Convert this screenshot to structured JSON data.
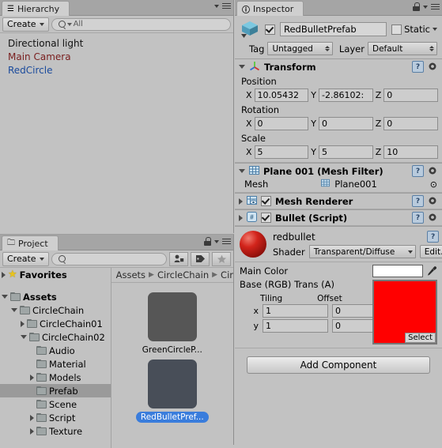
{
  "hierarchy": {
    "tab_label": "Hierarchy",
    "create_label": "Create",
    "search_placeholder": "All",
    "items": [
      {
        "label": "Directional light",
        "color": "#111111"
      },
      {
        "label": "Main Camera",
        "color": "#7a2020"
      },
      {
        "label": "RedCircle",
        "color": "#1a4a9c"
      }
    ]
  },
  "project": {
    "tab_label": "Project",
    "create_label": "Create",
    "search_placeholder": "",
    "favorites_label": "Favorites",
    "tree": [
      {
        "label": "Assets",
        "depth": 0,
        "state": "open",
        "bold": true
      },
      {
        "label": "CircleChain",
        "depth": 1,
        "state": "open",
        "bold": false
      },
      {
        "label": "CircleChain01",
        "depth": 2,
        "state": "closed",
        "bold": false
      },
      {
        "label": "CircleChain02",
        "depth": 2,
        "state": "open",
        "bold": false
      },
      {
        "label": "Audio",
        "depth": 3,
        "state": "leaf",
        "bold": false
      },
      {
        "label": "Material",
        "depth": 3,
        "state": "leaf",
        "bold": false
      },
      {
        "label": "Models",
        "depth": 3,
        "state": "closed",
        "bold": false
      },
      {
        "label": "Prefab",
        "depth": 3,
        "state": "leaf",
        "bold": false,
        "selected": true
      },
      {
        "label": "Scene",
        "depth": 3,
        "state": "leaf",
        "bold": false
      },
      {
        "label": "Script",
        "depth": 3,
        "state": "closed",
        "bold": false
      },
      {
        "label": "Texture",
        "depth": 3,
        "state": "closed",
        "bold": false
      }
    ],
    "breadcrumb": [
      "Assets",
      "CircleChain",
      "Cir"
    ],
    "assets": [
      {
        "label": "GreenCircleP...",
        "color": "#565656",
        "selected": false
      },
      {
        "label": "RedBulletPref...",
        "color": "#484e58",
        "selected": true
      }
    ]
  },
  "inspector": {
    "tab_label": "Inspector",
    "object_name": "RedBulletPrefab",
    "object_enabled": true,
    "static_label": "Static",
    "static_checked": false,
    "tag_label": "Tag",
    "tag_value": "Untagged",
    "layer_label": "Layer",
    "layer_value": "Default",
    "transform": {
      "title": "Transform",
      "position_label": "Position",
      "rotation_label": "Rotation",
      "scale_label": "Scale",
      "axis_x": "X",
      "axis_y": "Y",
      "axis_z": "Z",
      "position": {
        "x": "10.05432",
        "y": "-2.86102:",
        "z": "0"
      },
      "rotation": {
        "x": "0",
        "y": "0",
        "z": "0"
      },
      "scale": {
        "x": "5",
        "y": "5",
        "z": "10"
      }
    },
    "mesh_filter": {
      "title": "Plane 001 (Mesh Filter)",
      "mesh_label": "Mesh",
      "mesh_value": "Plane001"
    },
    "mesh_renderer": {
      "title": "Mesh Renderer",
      "enabled": true
    },
    "bullet_script": {
      "title": "Bullet (Script)",
      "enabled": true
    },
    "material": {
      "name": "redbullet",
      "shader_label": "Shader",
      "shader_value": "Transparent/Diffuse",
      "edit_label": "Edit...",
      "main_color_label": "Main Color",
      "main_color_value": "#ffffff",
      "base_label": "Base (RGB) Trans (A)",
      "texture_color": "#ff0000",
      "select_label": "Select",
      "tiling_label": "Tiling",
      "offset_label": "Offset",
      "row_x_label": "x",
      "row_y_label": "y",
      "tiling_x": "1",
      "tiling_y": "1",
      "offset_x": "0",
      "offset_y": "0"
    },
    "add_component_label": "Add Component"
  }
}
